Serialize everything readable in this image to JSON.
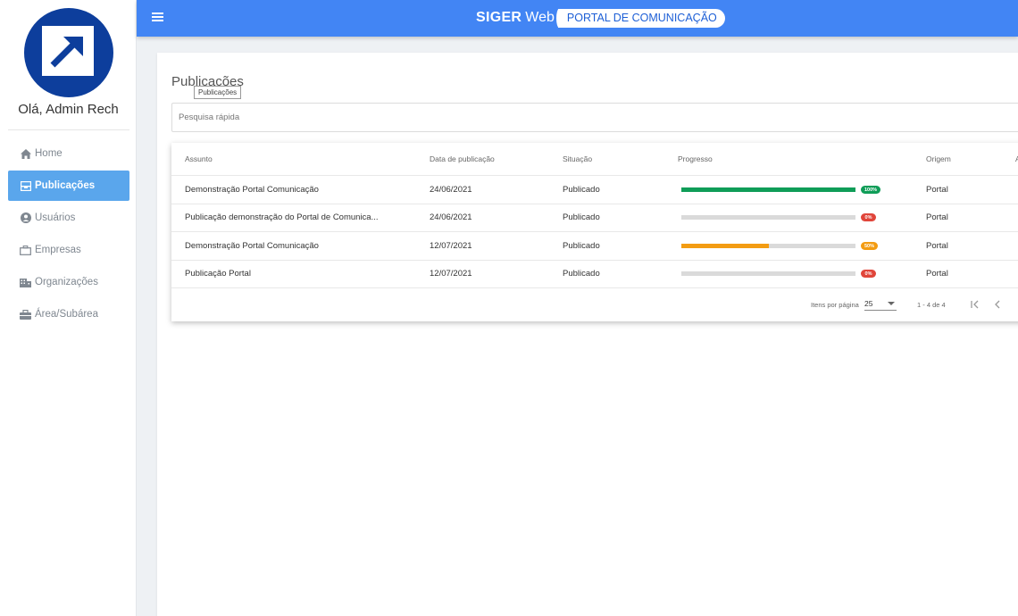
{
  "topbar": {
    "brand_name": "SIGER",
    "brand_web": "Web",
    "brand_pill": "PORTAL DE COMUNICAÇÃO"
  },
  "sidebar": {
    "greeting": "Olá, Admin Rech",
    "items": [
      {
        "label": "Home",
        "icon": "home-icon",
        "active": false
      },
      {
        "label": "Publicações",
        "icon": "inbox-icon",
        "active": true
      },
      {
        "label": "Usuários",
        "icon": "user-icon",
        "active": false
      },
      {
        "label": "Empresas",
        "icon": "briefcase-icon",
        "active": false
      },
      {
        "label": "Organizações",
        "icon": "building-icon",
        "active": false
      },
      {
        "label": "Área/Subárea",
        "icon": "toolbox-icon",
        "active": false
      }
    ]
  },
  "main": {
    "title": "Publicações",
    "tooltip": "Publicações",
    "search_placeholder": "Pesquisa rápida",
    "columns": [
      "Assunto",
      "Data de publicação",
      "Situação",
      "Progresso",
      "Origem",
      "A"
    ],
    "rows": [
      {
        "assunto": "Demonstração Portal Comunicação",
        "data": "24/06/2021",
        "situacao": "Publicado",
        "progresso": 100,
        "progresso_label": "100%",
        "origem": "Portal"
      },
      {
        "assunto": "Publicação demonstração do Portal de Comunica...",
        "data": "24/06/2021",
        "situacao": "Publicado",
        "progresso": 0,
        "progresso_label": "0%",
        "origem": "Portal"
      },
      {
        "assunto": "Demonstração Portal Comunicação",
        "data": "12/07/2021",
        "situacao": "Publicado",
        "progresso": 50,
        "progresso_label": "50%",
        "origem": "Portal"
      },
      {
        "assunto": "Publicação Portal",
        "data": "12/07/2021",
        "situacao": "Publicado",
        "progresso": 0,
        "progresso_label": "0%",
        "origem": "Portal"
      }
    ],
    "pager": {
      "items_label": "Itens por página",
      "page_size": "25",
      "range": "1 - 4 de 4"
    }
  },
  "colors": {
    "primary": "#4285f4",
    "sidebar_active": "#5aa6ec",
    "progress_full": "#0f9d58",
    "progress_half": "#f39c12",
    "progress_zero": "#e0453a"
  }
}
